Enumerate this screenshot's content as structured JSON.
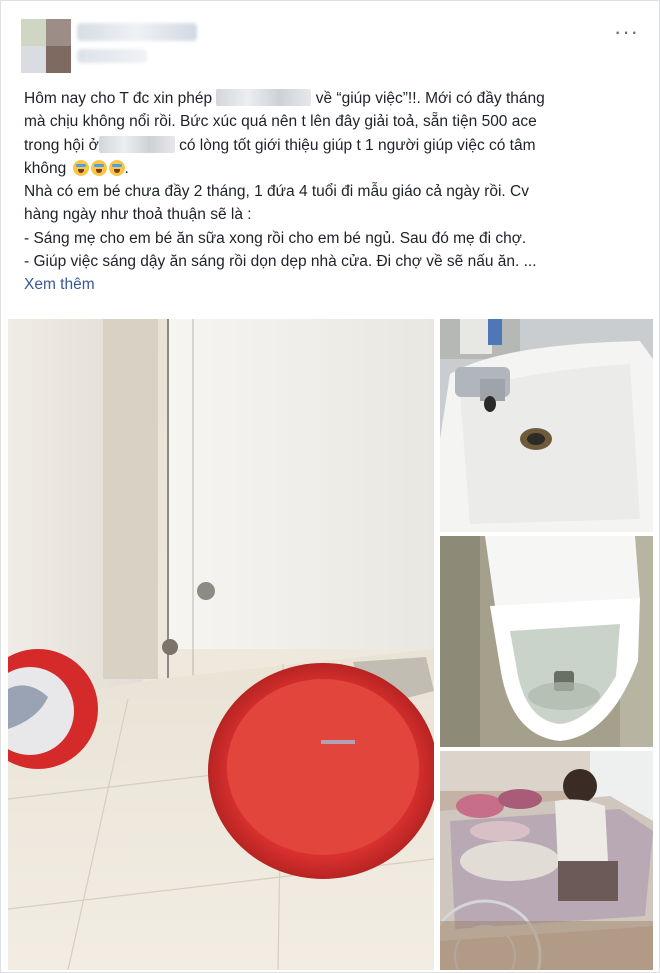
{
  "header": {
    "more_icon": "more-options-icon"
  },
  "post": {
    "line1_a": "Hôm nay cho T đc xin phép",
    "line1_b": "về “giúp việc”!!. Mới có đầy tháng",
    "line2": "mà chịu không nổi rồi. Bức xúc quá nên t lên đây giải toả, sẵn tiện 500 ace",
    "line3_a": "trong hội ở",
    "line3_b": "có lòng tốt giới thiệu giúp t 1 người giúp việc có tâm",
    "line4": "không",
    "line5": "Nhà có em bé chưa đầy 2 tháng, 1 đứa 4 tuổi đi mẫu giáo cả ngày rồi. Cv",
    "line6": "hàng ngày như thoả thuận sẽ là :",
    "line7": "- Sáng mẹ cho em bé ăn sữa xong rồi cho em bé ngủ. Sau đó mẹ đi chợ.",
    "line8": "- Giúp việc sáng dậy ăn sáng rồi dọn dẹp nhà cửa. Đi chợ về sẽ nấu ăn. ...",
    "see_more": "Xem thêm"
  },
  "photos": [
    {
      "name": "bathroom-floor-photo"
    },
    {
      "name": "sink-photo"
    },
    {
      "name": "toilet-photo"
    },
    {
      "name": "room-photo"
    }
  ],
  "colors": {
    "link": "#385898",
    "text": "#1d2129",
    "basin_red": "#d8302f"
  }
}
